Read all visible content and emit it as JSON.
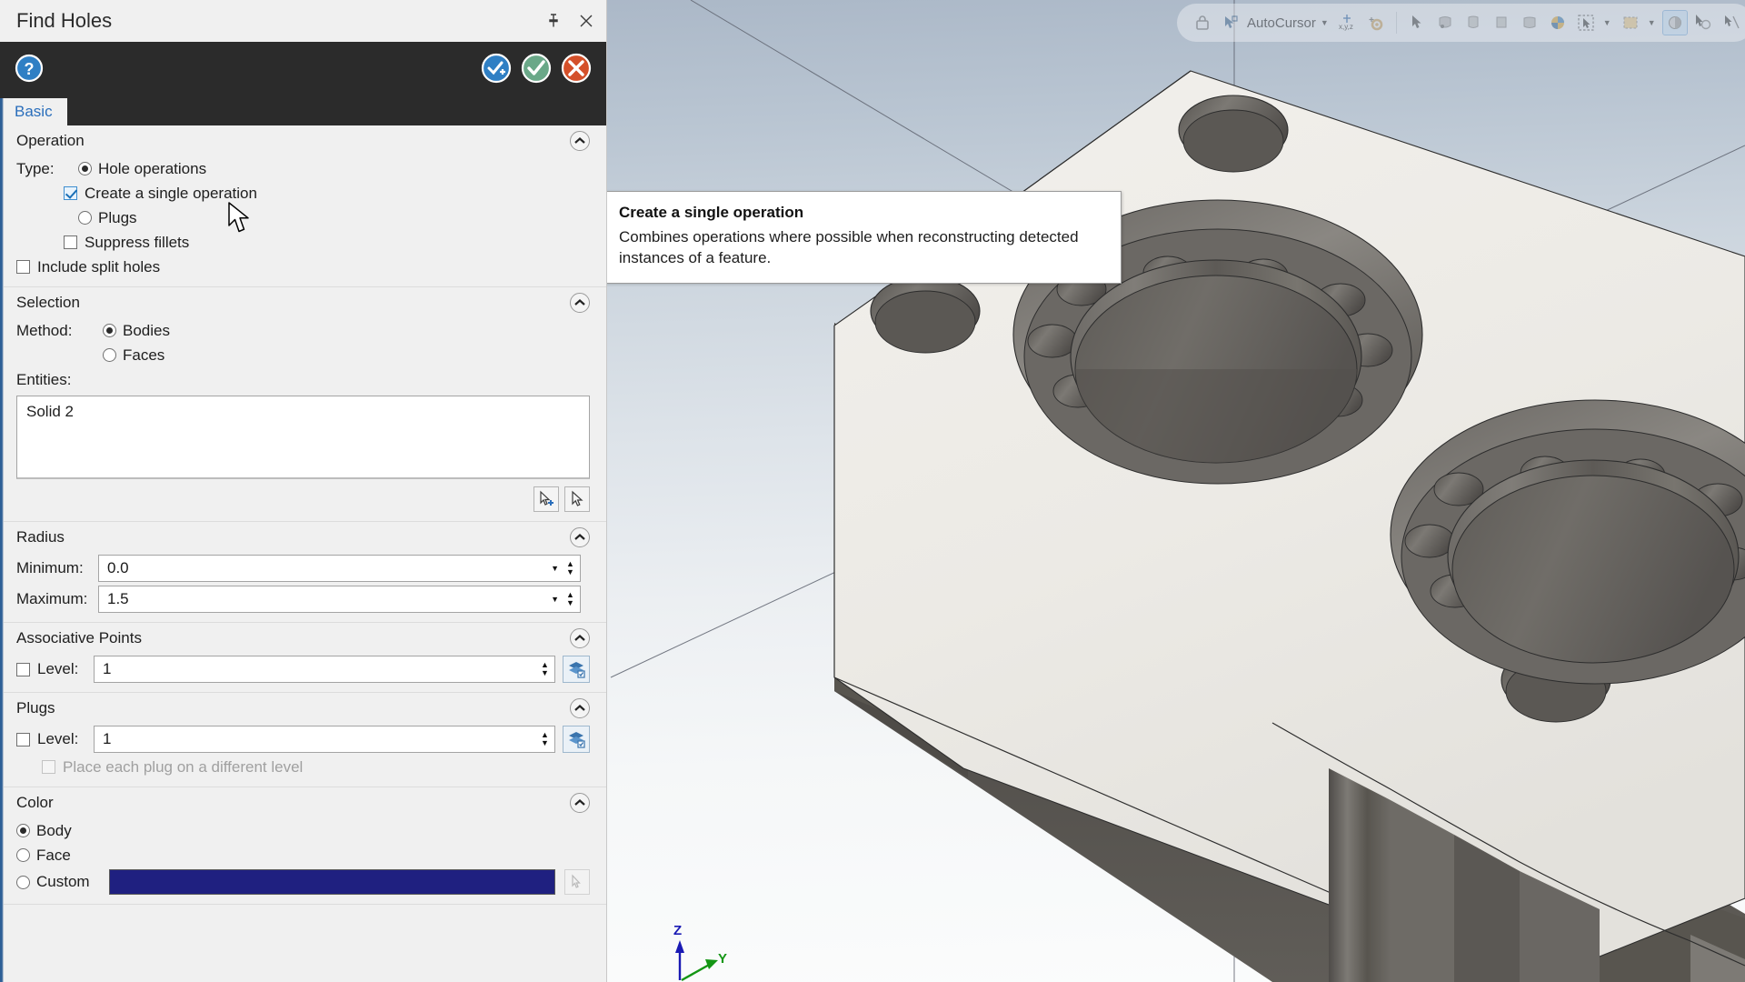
{
  "window": {
    "title": "Find Holes",
    "pin_icon": "pin-icon",
    "close_icon": "close-icon"
  },
  "header": {
    "help_icon": "help-icon",
    "actions": [
      {
        "name": "apply-and-create-new-button",
        "icon": "check-plus-icon",
        "color": "#2f7fc4"
      },
      {
        "name": "ok-button",
        "icon": "check-icon",
        "color": "#6aa888"
      },
      {
        "name": "cancel-button",
        "icon": "x-icon",
        "color": "#d4502a"
      }
    ]
  },
  "tabs": [
    {
      "label": "Basic",
      "active": true
    }
  ],
  "sections": {
    "operation": {
      "title": "Operation",
      "type_label": "Type:",
      "options": [
        {
          "label": "Hole operations",
          "selected": true
        },
        {
          "label": "Plugs",
          "selected": false
        }
      ],
      "create_single_operation": {
        "label": "Create a single operation",
        "checked": true
      },
      "suppress_fillets": {
        "label": "Suppress fillets",
        "checked": false
      },
      "include_split_holes": {
        "label": "Include split holes",
        "checked": false
      }
    },
    "selection": {
      "title": "Selection",
      "method_label": "Method:",
      "methods": [
        {
          "label": "Bodies",
          "selected": true
        },
        {
          "label": "Faces",
          "selected": false
        }
      ],
      "entities_label": "Entities:",
      "entities_value": "Solid 2",
      "buttons": [
        {
          "name": "select-entities-button",
          "icon": "cursor-plus-icon"
        },
        {
          "name": "clear-selection-button",
          "icon": "cursor-icon"
        }
      ]
    },
    "radius": {
      "title": "Radius",
      "minimum_label": "Minimum:",
      "minimum_value": "0.0",
      "maximum_label": "Maximum:",
      "maximum_value": "1.5"
    },
    "associative_points": {
      "title": "Associative Points",
      "level_label": "Level:",
      "level_checked": false,
      "level_value": "1",
      "level_button_icon": "layers-icon"
    },
    "plugs": {
      "title": "Plugs",
      "level_label": "Level:",
      "level_checked": false,
      "level_value": "1",
      "level_button_icon": "layers-icon",
      "place_each_plug_label": "Place each plug on a different level",
      "place_each_plug_checked": false,
      "place_each_plug_disabled": true
    },
    "color": {
      "title": "Color",
      "options": [
        {
          "label": "Body",
          "selected": true
        },
        {
          "label": "Face",
          "selected": false
        },
        {
          "label": "Custom",
          "selected": false
        }
      ],
      "custom_color": "#1f2080",
      "picker_icon": "color-picker-icon"
    }
  },
  "tooltip": {
    "title": "Create a single operation",
    "body": "Combines operations where possible when reconstructing detected instances of a feature."
  },
  "toolbar": {
    "lock_icon": "lock-icon",
    "autocursor_icon": "autocursor-icon",
    "autocursor_label": "AutoCursor",
    "dropdown_caret": "chevron-down-icon",
    "items": [
      {
        "name": "xyz-point-icon",
        "icon": "xyz-icon"
      },
      {
        "name": "autocursor-settings-icon",
        "icon": "gear-icon"
      },
      {
        "name": "select-arrow-icon",
        "icon": "arrow-icon"
      },
      {
        "name": "select-vertex-icon",
        "icon": "vertex-icon"
      },
      {
        "name": "select-edge-icon",
        "icon": "edge-icon"
      },
      {
        "name": "select-face-icon",
        "icon": "face-icon"
      },
      {
        "name": "select-body-icon",
        "icon": "body-icon"
      },
      {
        "name": "select-solid-icon",
        "icon": "solid-icon"
      },
      {
        "name": "select-all-icon",
        "icon": "select-all-icon"
      },
      {
        "name": "selection-mask-icon",
        "icon": "mask-icon"
      },
      {
        "name": "window-select-icon",
        "icon": "window-icon"
      },
      {
        "name": "shade-toggle-icon",
        "icon": "shade-icon"
      },
      {
        "name": "analyze-icon",
        "icon": "analyze-icon"
      }
    ]
  },
  "viewport": {
    "axis": {
      "z_label": "Z",
      "y_label": "Y",
      "z_color": "#1a1ab4",
      "y_color": "#149614"
    },
    "model_name": "Solid 2"
  }
}
